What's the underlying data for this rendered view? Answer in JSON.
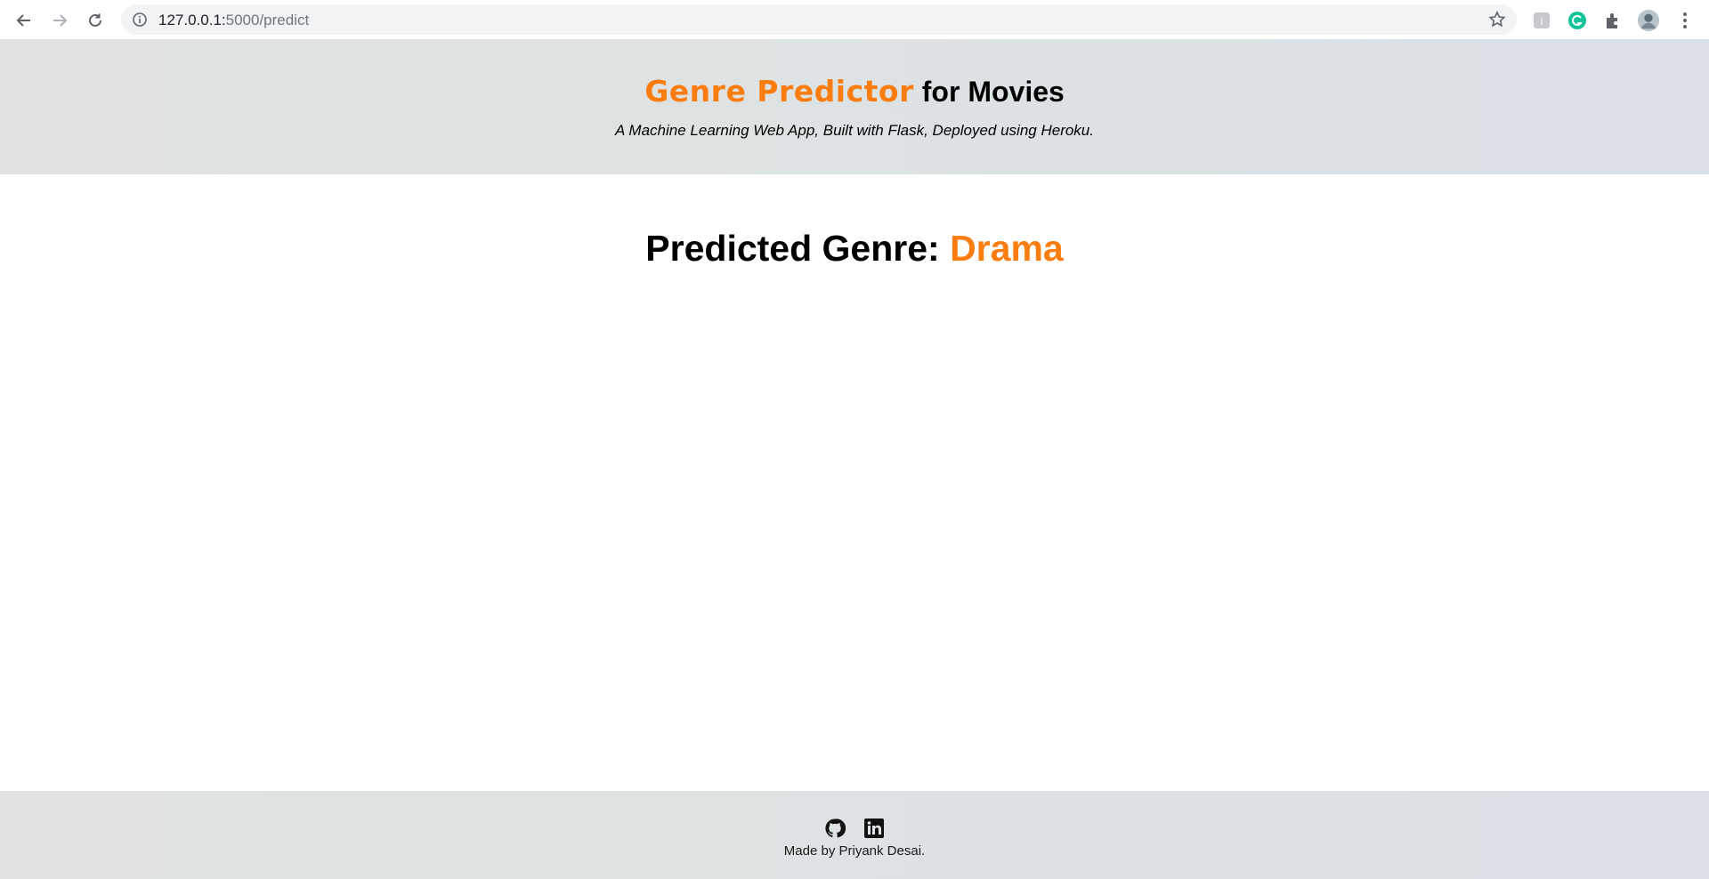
{
  "browser": {
    "url_host": "127.0.0.1:",
    "url_path": "5000/predict",
    "icons": [
      "back-icon",
      "forward-icon",
      "reload-icon",
      "info-icon",
      "star-icon",
      "extension-icon",
      "grammarly-icon",
      "puzzle-icon",
      "profile-avatar",
      "menu-icon"
    ]
  },
  "header": {
    "brand": "Genre Predictor",
    "title_rest": " for Movies",
    "subtitle": "A Machine Learning Web App, Built with Flask, Deployed using Heroku."
  },
  "result": {
    "label": "Predicted Genre: ",
    "genre": "Drama"
  },
  "footer": {
    "icons": [
      "github-icon",
      "linkedin-icon"
    ],
    "credit": "Made by Priyank Desai."
  },
  "colors": {
    "accent": "#fb7d0f",
    "header_bg": "#dee2e4"
  }
}
